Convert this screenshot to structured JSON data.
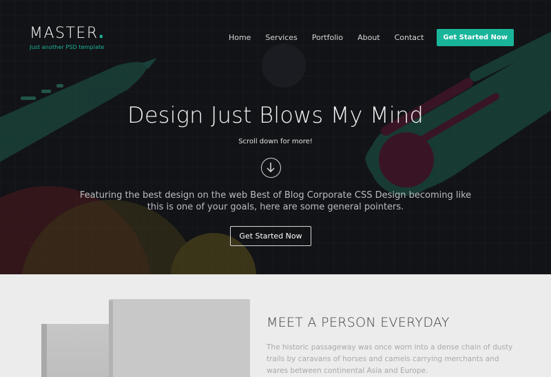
{
  "header": {
    "logo_text": "MASTER",
    "logo_dot": ".",
    "tagline": "Just another PSD template"
  },
  "nav": {
    "items": [
      "Home",
      "Services",
      "Portfolio",
      "About",
      "Contact"
    ],
    "cta_label": "Get Started Now"
  },
  "hero": {
    "title": "Design Just Blows My Mind",
    "scroll_text": "Scroll down for more!",
    "description": "Featuring the best design on the web Best of Blog Corporate CSS Design becoming like this is one of your goals, here are some general pointers.",
    "cta_label": "Get Started Now"
  },
  "feature": {
    "title": "MEET A PERSON EVERYDAY",
    "text": "The historic passageway was once worn into a dense chain of dusty trails by caravans of horses and camels carrying merchants and wares between continental Asia and Europe."
  },
  "colors": {
    "accent": "#19b59b",
    "hero_bg": "#121316",
    "section_bg": "#ececec"
  },
  "icons": {
    "scroll": "arrow-down-circle-icon"
  }
}
